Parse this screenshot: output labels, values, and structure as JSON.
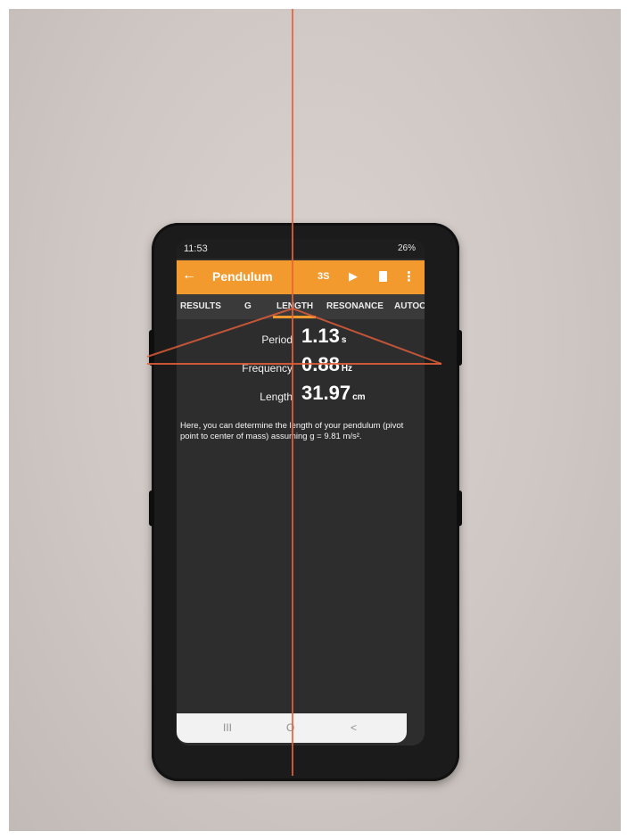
{
  "status_bar": {
    "time": "11:53",
    "battery": "26%"
  },
  "app_bar": {
    "back_glyph": "←",
    "title": "Pendulum",
    "timer_button": "3S",
    "play_glyph": "▶",
    "menu_glyph": "⋮"
  },
  "tabs": [
    "RESULTS",
    "G",
    "LENGTH",
    "RESONANCE",
    "AUTOC"
  ],
  "metrics": [
    {
      "label": "Period",
      "value": "1.13",
      "unit": "s"
    },
    {
      "label": "Frequency",
      "value": "0.88",
      "unit": "Hz"
    },
    {
      "label": "Length",
      "value": "31.97",
      "unit": "cm"
    }
  ],
  "description": "Here, you can determine the length of your pendulum (pivot point to center of mass) assuming g = 9.81 m/s².",
  "nav_bar": {
    "recents": "III",
    "home": "O",
    "back": "<"
  },
  "colors": {
    "accent": "#f29a2e",
    "laser": "#e8603a",
    "screen_bg": "#2d2d2d",
    "wall": "#cfc7c3"
  },
  "icons": [
    "back-arrow-icon",
    "play-icon",
    "trash-icon",
    "overflow-menu-icon"
  ]
}
